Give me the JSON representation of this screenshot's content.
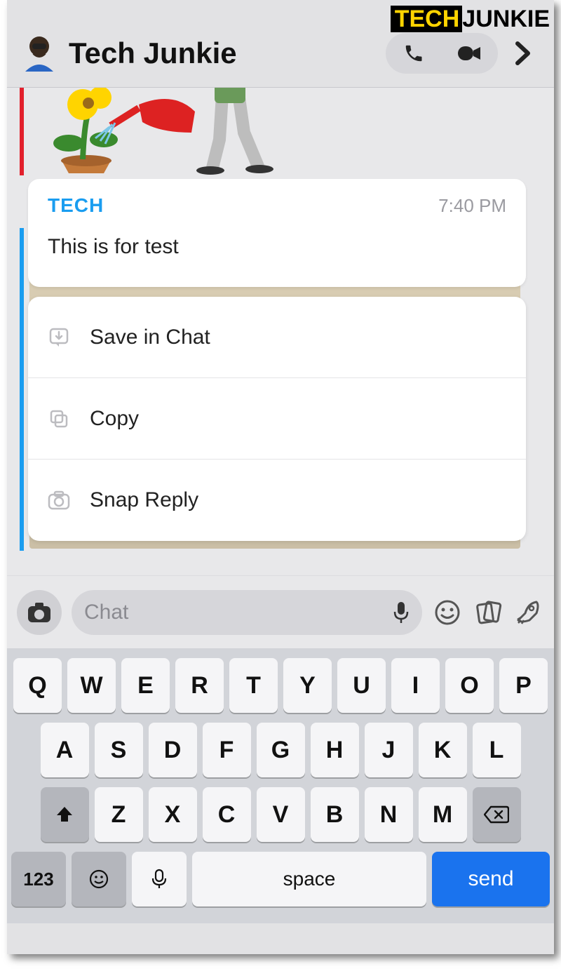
{
  "watermark": {
    "part1": "TECH",
    "part2": "JUNKIE"
  },
  "header": {
    "title": "Tech Junkie",
    "audio_call": "audio-call",
    "video_call": "video-call"
  },
  "message": {
    "sender": "TECH",
    "time": "7:40 PM",
    "text": "This is for test"
  },
  "menu": {
    "items": [
      {
        "icon": "save-in-chat-icon",
        "label": "Save in Chat"
      },
      {
        "icon": "copy-icon",
        "label": "Copy"
      },
      {
        "icon": "snap-reply-icon",
        "label": "Snap Reply"
      }
    ]
  },
  "input_bar": {
    "placeholder": "Chat"
  },
  "keyboard": {
    "row1": [
      "Q",
      "W",
      "E",
      "R",
      "T",
      "Y",
      "U",
      "I",
      "O",
      "P"
    ],
    "row2": [
      "A",
      "S",
      "D",
      "F",
      "G",
      "H",
      "J",
      "K",
      "L"
    ],
    "row3": [
      "Z",
      "X",
      "C",
      "V",
      "B",
      "N",
      "M"
    ],
    "k123": "123",
    "space": "space",
    "send": "send"
  }
}
